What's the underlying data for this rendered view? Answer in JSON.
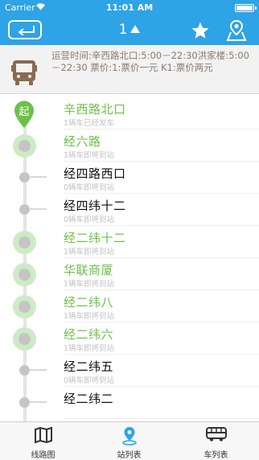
{
  "status_bar": {
    "carrier": "Carrier",
    "time": "11:01 AM"
  },
  "nav": {
    "route_number": "1"
  },
  "info": {
    "text": "运营时间:辛西路北口:5:00－22:30洪家楼:5:00－22:30 票价:1:票价一元  K1:票价两元"
  },
  "stops": [
    {
      "name": "辛西路北口",
      "status": "1辆车已经发车",
      "color": "green",
      "marker": "start"
    },
    {
      "name": "经六路",
      "status": "1辆车即将到站",
      "color": "green",
      "marker": "big"
    },
    {
      "name": "经四路西口",
      "status": "0辆车即将到站",
      "color": "black",
      "marker": "small"
    },
    {
      "name": "经四纬十二",
      "status": "0辆车即将到站",
      "color": "black",
      "marker": "small"
    },
    {
      "name": "经二纬十二",
      "status": "1辆车即将到站",
      "color": "green",
      "marker": "big"
    },
    {
      "name": "华联商厦",
      "status": "1辆车即将到站",
      "color": "green",
      "marker": "big"
    },
    {
      "name": "经二纬八",
      "status": "1辆车即将到站",
      "color": "green",
      "marker": "big"
    },
    {
      "name": "经二纬六",
      "status": "1辆车即将到站",
      "color": "green",
      "marker": "big"
    },
    {
      "name": "经二纬五",
      "status": "0辆车即将到站",
      "color": "black",
      "marker": "small"
    },
    {
      "name": "经二纬二",
      "status": "",
      "color": "black",
      "marker": "small"
    }
  ],
  "start_marker_label": "起",
  "tabs": [
    {
      "label": "线路图",
      "icon": "map-icon"
    },
    {
      "label": "站列表",
      "icon": "location-pin-icon"
    },
    {
      "label": "车列表",
      "icon": "bus-icon"
    }
  ],
  "colors": {
    "primary": "#2ea3e6",
    "green": "#6cc14b",
    "info_text": "#8a7a6e"
  }
}
